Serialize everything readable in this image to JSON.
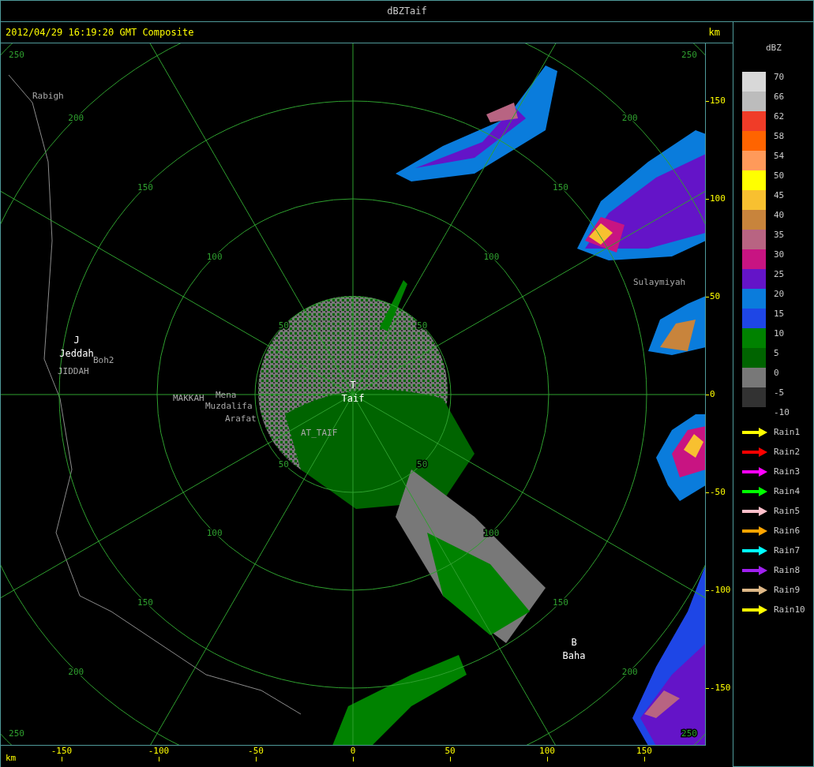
{
  "window": {
    "title": "dBZTaif"
  },
  "header": {
    "timestamp": "2012/04/29 16:19:20 GMT Composite",
    "unit": "km"
  },
  "range_rings": [
    {
      "labels": [
        "50",
        "50",
        "50",
        "50"
      ]
    },
    {
      "labels": [
        "100",
        "100",
        "100",
        "100"
      ]
    },
    {
      "labels": [
        "150",
        "150",
        "150",
        "150"
      ]
    },
    {
      "labels": [
        "200",
        "200",
        "200",
        "200"
      ]
    },
    {
      "labels": [
        "250",
        "250",
        "250",
        "250"
      ]
    }
  ],
  "places": [
    {
      "kind": "place",
      "name": "Rabigh"
    },
    {
      "kind": "site",
      "marker": "J",
      "name": "Jeddah"
    },
    {
      "kind": "place",
      "name": "Boh2"
    },
    {
      "kind": "place",
      "name": "JIDDAH"
    },
    {
      "kind": "place",
      "name": "MAKKAH"
    },
    {
      "kind": "place",
      "name": "Mena"
    },
    {
      "kind": "place",
      "name": "Muzdalifa"
    },
    {
      "kind": "place",
      "name": "Arafat"
    },
    {
      "kind": "place",
      "name": "AT_TAIF"
    },
    {
      "kind": "site",
      "marker": "T",
      "name": "Taif"
    },
    {
      "kind": "place",
      "name": "Sulaymiyah"
    },
    {
      "kind": "site",
      "marker": "B",
      "name": "Baha"
    }
  ],
  "y_axis": {
    "ticks": [
      "150",
      "100",
      "50",
      "0",
      "-50",
      "-100",
      "-150"
    ]
  },
  "x_axis": {
    "unit": "km",
    "ticks": [
      "-150",
      "-100",
      "-50",
      "0",
      "50",
      "100",
      "150"
    ]
  },
  "legend": {
    "title": "dBZ",
    "bins": [
      {
        "color": "#d8d8d8"
      },
      {
        "color": "#bcbcbc"
      },
      {
        "color": "#f03c28"
      },
      {
        "color": "#ff6400"
      },
      {
        "color": "#ff9a5a"
      },
      {
        "color": "#ffff00"
      },
      {
        "color": "#f8c030"
      },
      {
        "color": "#c8843c"
      },
      {
        "color": "#b86482"
      },
      {
        "color": "#c81482"
      },
      {
        "color": "#6414c8"
      },
      {
        "color": "#0a7cdc"
      },
      {
        "color": "#1e46e6"
      },
      {
        "color": "#008200"
      },
      {
        "color": "#006400"
      },
      {
        "color": "#787878"
      },
      {
        "color": "#323232"
      }
    ],
    "labels": [
      "70",
      "66",
      "62",
      "58",
      "54",
      "50",
      "45",
      "40",
      "35",
      "30",
      "25",
      "20",
      "15",
      "10",
      "5",
      "0",
      "-5",
      "-10"
    ],
    "tracks": [
      {
        "label": "Rain1",
        "color": "#ffff00"
      },
      {
        "label": "Rain2",
        "color": "#ff0000"
      },
      {
        "label": "Rain3",
        "color": "#ff00ff"
      },
      {
        "label": "Rain4",
        "color": "#00ff00"
      },
      {
        "label": "Rain5",
        "color": "#ffc0cb"
      },
      {
        "label": "Rain6",
        "color": "#ffa500"
      },
      {
        "label": "Rain7",
        "color": "#00ffff"
      },
      {
        "label": "Rain8",
        "color": "#a020f0"
      },
      {
        "label": "Rain9",
        "color": "#deb887"
      },
      {
        "label": "Rain10",
        "color": "#ffff00"
      }
    ]
  }
}
